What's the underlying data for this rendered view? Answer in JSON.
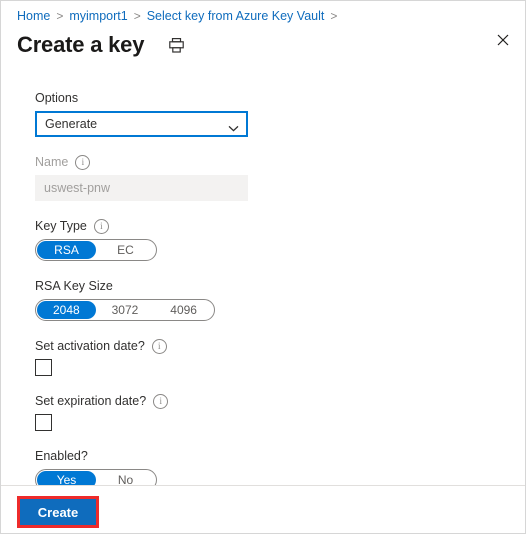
{
  "breadcrumb": {
    "separator": ">",
    "items": [
      {
        "label": "Home"
      },
      {
        "label": "myimport1"
      },
      {
        "label": "Select key from Azure Key Vault"
      }
    ],
    "trailing_separator": ">"
  },
  "header": {
    "title": "Create a key",
    "print_icon": "printer-icon",
    "close_icon": "close-icon"
  },
  "form": {
    "options": {
      "label": "Options",
      "value": "Generate",
      "chevron_icon": "chevron-down-icon"
    },
    "name": {
      "label": "Name",
      "info_icon": "info-icon",
      "value": "uswest-pnw",
      "disabled": true
    },
    "key_type": {
      "label": "Key Type",
      "info_icon": "info-icon",
      "options": [
        "RSA",
        "EC"
      ],
      "selected": "RSA"
    },
    "rsa_key_size": {
      "label": "RSA Key Size",
      "options": [
        "2048",
        "3072",
        "4096"
      ],
      "selected": "2048"
    },
    "activation_date": {
      "label": "Set activation date?",
      "info_icon": "info-icon",
      "checked": false
    },
    "expiration_date": {
      "label": "Set expiration date?",
      "info_icon": "info-icon",
      "checked": false
    },
    "enabled": {
      "label": "Enabled?",
      "options": [
        "Yes",
        "No"
      ],
      "selected": "Yes"
    }
  },
  "footer": {
    "create_label": "Create"
  },
  "colors": {
    "accent_blue": "#0078d4",
    "link_blue": "#0f6cbd",
    "button_blue": "#0f6cbd",
    "annotation_red": "#ee2b2b",
    "disabled_bg": "#f3f2f1",
    "disabled_text": "#a19f9d"
  }
}
